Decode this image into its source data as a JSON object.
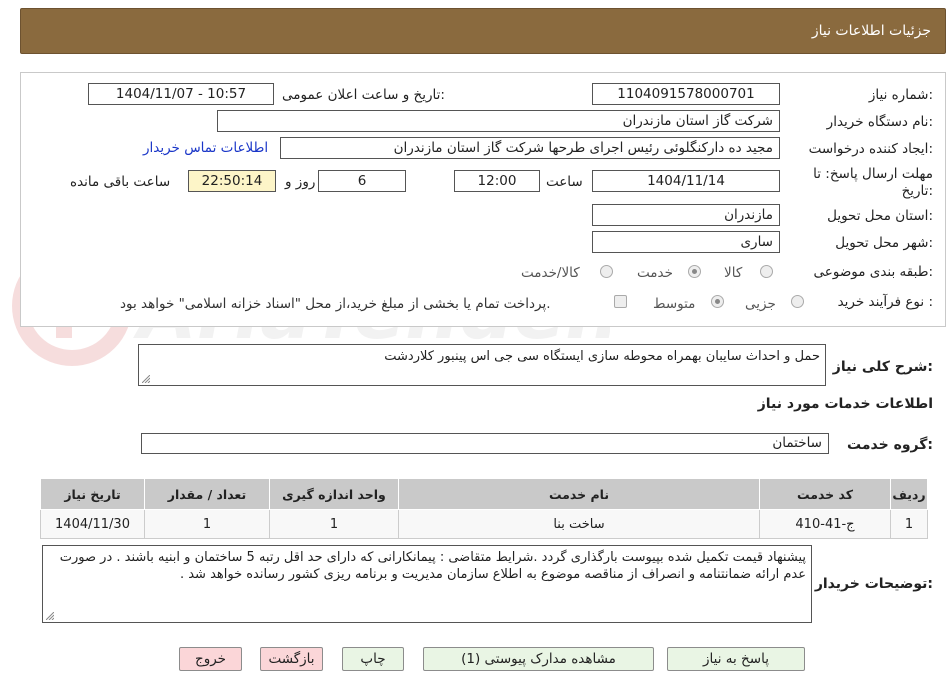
{
  "header": {
    "title": "جزئیات اطلاعات نیاز"
  },
  "form": {
    "need_number_label": "شماره نیاز:",
    "need_number": "1104091578000701",
    "announce_label": "تاریخ و ساعت اعلان عمومی:",
    "announce_value": "1404/11/07 - 10:57",
    "buyer_org_label": "نام دستگاه خریدار:",
    "buyer_org": "شرکت گاز استان مازندران",
    "creator_label": "ایجاد کننده درخواست:",
    "creator": "مجید ده دارکنگلوئی رئیس اجرای طرحها شرکت گاز استان مازندران",
    "contact_link": "اطلاعات تماس خریدار",
    "deadline_label_1": "مهلت ارسال پاسخ: تا",
    "deadline_label_2": "تاریخ:",
    "deadline_date": "1404/11/14",
    "time_label": "ساعت",
    "deadline_time": "12:00",
    "days_value": "6",
    "days_label": "روز و",
    "remaining_time": "22:50:14",
    "remaining_label": "ساعت باقی مانده",
    "province_label": "استان محل تحویل:",
    "province": "مازندران",
    "city_label": "شهر محل تحویل:",
    "city": "ساری",
    "category_label": "طبقه بندی موضوعی:",
    "category_options": [
      "کالا",
      "خدمت",
      "کالا/خدمت"
    ],
    "category_selected": "خدمت",
    "purchase_type_label": "نوع فرآیند خرید :",
    "purchase_options": [
      "جزیی",
      "متوسط"
    ],
    "purchase_selected": "متوسط",
    "treasury_note": "پرداخت تمام یا بخشی از مبلغ خرید،از محل \"اسناد خزانه اسلامی\" خواهد بود."
  },
  "description": {
    "label": "شرح کلی نیاز:",
    "text": "حمل و احداث سایبان بهمراه محوطه سازی ایستگاه سی جی اس پینبور کلاردشت"
  },
  "services": {
    "section_title": "اطلاعات خدمات مورد نیاز",
    "group_label": "گروه خدمت:",
    "group_value": "ساختمان",
    "columns": [
      "ردیف",
      "کد خدمت",
      "نام خدمت",
      "واحد اندازه گیری",
      "تعداد / مقدار",
      "تاریخ نیاز"
    ],
    "rows": [
      [
        "1",
        "ج-41-410",
        "ساخت بنا",
        "1",
        "1",
        "1404/11/30"
      ]
    ]
  },
  "buyer_notes": {
    "label": "توضیحات خریدار:",
    "text": "پیشنهاد قیمت تکمیل شده بپیوست  بارگذاری گردد .شرایط متقاضی : پیمانکارانی که دارای حد اقل رتبه 5 ساختمان و ابنیه باشند . در صورت عدم ارائه ضمانتنامه و انصراف از مناقصه موضوع به اطلاع سازمان مدیریت و برنامه ریزی کشور رسانده خواهد شد ."
  },
  "buttons": {
    "reply": "پاسخ به نیاز",
    "attachments": "مشاهده مدارک پیوستی (1)",
    "print": "چاپ",
    "back": "بازگشت",
    "exit": "خروج"
  },
  "watermark": {
    "text": "AriaTender.neT"
  },
  "colors": {
    "header_bg": "#8a6a3e",
    "link": "#1a36c8",
    "remaining_bg": "#fdf5c8",
    "table_header_bg": "#c9c9c9",
    "button_green": "#e9f5e4",
    "button_pink": "#fbd6d8"
  }
}
